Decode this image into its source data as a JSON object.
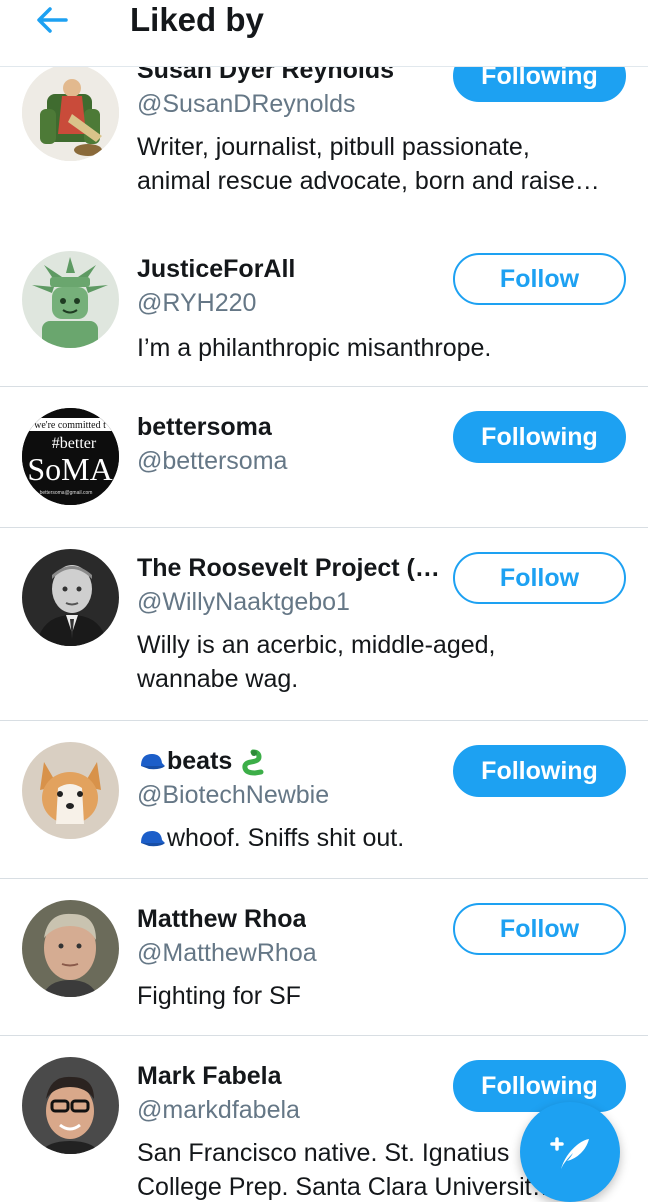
{
  "header": {
    "title": "Liked by",
    "back_icon": "arrow-left-icon"
  },
  "colors": {
    "accent": "#1da1f2",
    "secondary_text": "#657786",
    "divider": "#e1e8ed"
  },
  "users": [
    {
      "name": "Susan Dyer Reynolds",
      "handle": "@SusanDReynolds",
      "bio": [
        "Writer, journalist, pitbull passionate,",
        "animal rescue advocate, born and raise…"
      ],
      "button": "Following"
    },
    {
      "name": "JusticeForAll",
      "handle": "@RYH220",
      "bio": [
        "I’m a philanthropic misanthrope."
      ],
      "button": "Follow"
    },
    {
      "name": "bettersoma",
      "handle": "@bettersoma",
      "bio": [],
      "button": "Following",
      "avatar_text": {
        "top": "we're committed t",
        "mid": "#better",
        "big": "SoMA",
        "small": "bettersoma@gmail.com"
      }
    },
    {
      "name": "The Roosevelt Project (b…",
      "handle": "@WillyNaaktgebo1",
      "bio": [
        "Willy is an acerbic, middle-aged,",
        "wannabe wag."
      ],
      "button": "Follow"
    },
    {
      "name": "beats",
      "handle": "@BiotechNewbie",
      "bio": [
        "whoof. Sniffs shit out."
      ],
      "button": "Following",
      "name_prefix_icon": "blue-cap-icon",
      "name_suffix_icon": "snake-icon"
    },
    {
      "name": "Matthew Rhoa",
      "handle": "@MatthewRhoa",
      "bio": [
        "Fighting for SF"
      ],
      "button": "Follow"
    },
    {
      "name": "Mark Fabela",
      "handle": "@markdfabela",
      "bio": [
        "San Francisco native. St. Ignatius",
        "College Prep. Santa Clara Universit…"
      ],
      "button": "Following"
    }
  ],
  "fab": {
    "icon": "compose-tweet-icon"
  }
}
